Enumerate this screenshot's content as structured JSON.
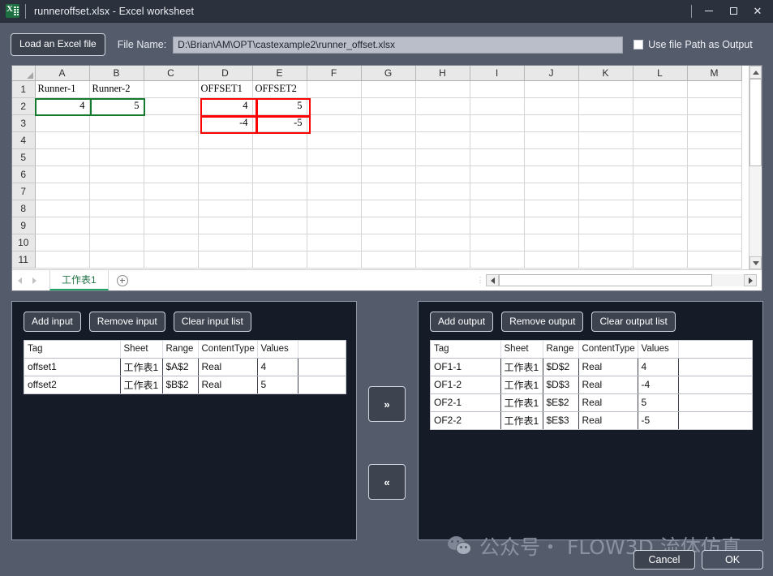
{
  "window": {
    "title": "runneroffset.xlsx - Excel worksheet",
    "icon": "excel-icon",
    "minimize": "–",
    "maximize": "□",
    "close": "✕"
  },
  "toolbar": {
    "load_button": "Load an Excel file",
    "filename_label": "File Name:",
    "filename_value": "D:\\Brian\\AM\\OPT\\castexample2\\runner_offset.xlsx",
    "use_path_checkbox_label": "Use file Path as Output",
    "use_path_checked": false
  },
  "spreadsheet": {
    "columns": [
      "A",
      "B",
      "C",
      "D",
      "E",
      "F",
      "G",
      "H",
      "I",
      "J",
      "K",
      "L",
      "M"
    ],
    "rows": [
      "1",
      "2",
      "3",
      "4",
      "5",
      "6",
      "7",
      "8",
      "9",
      "10",
      "11"
    ],
    "cells": [
      [
        "Runner-1",
        "Runner-2",
        "",
        "OFFSET1",
        "OFFSET2",
        "",
        "",
        "",
        "",
        "",
        "",
        "",
        ""
      ],
      [
        "4",
        "5",
        "",
        "4",
        "5",
        "",
        "",
        "",
        "",
        "",
        "",
        "",
        ""
      ],
      [
        "",
        "",
        "",
        "-4",
        "-5",
        "",
        "",
        "",
        "",
        "",
        "",
        "",
        ""
      ],
      [
        "",
        "",
        "",
        "",
        "",
        "",
        "",
        "",
        "",
        "",
        "",
        "",
        ""
      ],
      [
        "",
        "",
        "",
        "",
        "",
        "",
        "",
        "",
        "",
        "",
        "",
        "",
        ""
      ],
      [
        "",
        "",
        "",
        "",
        "",
        "",
        "",
        "",
        "",
        "",
        "",
        "",
        ""
      ],
      [
        "",
        "",
        "",
        "",
        "",
        "",
        "",
        "",
        "",
        "",
        "",
        "",
        ""
      ],
      [
        "",
        "",
        "",
        "",
        "",
        "",
        "",
        "",
        "",
        "",
        "",
        "",
        ""
      ],
      [
        "",
        "",
        "",
        "",
        "",
        "",
        "",
        "",
        "",
        "",
        "",
        "",
        ""
      ],
      [
        "",
        "",
        "",
        "",
        "",
        "",
        "",
        "",
        "",
        "",
        "",
        "",
        ""
      ],
      [
        "",
        "",
        "",
        "",
        "",
        "",
        "",
        "",
        "",
        "",
        "",
        "",
        ""
      ]
    ],
    "numeric_cells": [
      "A2",
      "B2",
      "D2",
      "E2",
      "D3",
      "E3"
    ],
    "selection_green": "A2:B2",
    "selection_red": "D2:E3",
    "sheet_tab": "工作表1",
    "add_sheet": "+",
    "selection_colors": {
      "green": "#137a2e",
      "red": "#ff0000"
    }
  },
  "input_panel": {
    "add_button": "Add input",
    "remove_button": "Remove input",
    "clear_button": "Clear input list",
    "headers": [
      "Tag",
      "Sheet",
      "Range",
      "ContentType",
      "Values",
      ""
    ],
    "rows": [
      {
        "tag": "offset1",
        "sheet": "工作表1",
        "range": "$A$2",
        "type": "Real",
        "value": "4",
        "extra": ""
      },
      {
        "tag": "offset2",
        "sheet": "工作表1",
        "range": "$B$2",
        "type": "Real",
        "value": "5",
        "extra": ""
      }
    ]
  },
  "output_panel": {
    "add_button": "Add output",
    "remove_button": "Remove output",
    "clear_button": "Clear output list",
    "headers": [
      "Tag",
      "Sheet",
      "Range",
      "ContentType",
      "Values",
      ""
    ],
    "rows": [
      {
        "tag": "OF1-1",
        "sheet": "工作表1",
        "range": "$D$2",
        "type": "Real",
        "value": "4",
        "extra": ""
      },
      {
        "tag": "OF1-2",
        "sheet": "工作表1",
        "range": "$D$3",
        "type": "Real",
        "value": "-4",
        "extra": ""
      },
      {
        "tag": "OF2-1",
        "sheet": "工作表1",
        "range": "$E$2",
        "type": "Real",
        "value": "5",
        "extra": ""
      },
      {
        "tag": "OF2-2",
        "sheet": "工作表1",
        "range": "$E$3",
        "type": "Real",
        "value": "-5",
        "extra": ""
      }
    ]
  },
  "transfer": {
    "to_output": "»",
    "to_input": "«"
  },
  "watermark": {
    "icon": "wechat-icon",
    "text": "公众号・ FLOW3D 流体仿真"
  },
  "footer": {
    "cancel": "Cancel",
    "ok": "OK"
  }
}
